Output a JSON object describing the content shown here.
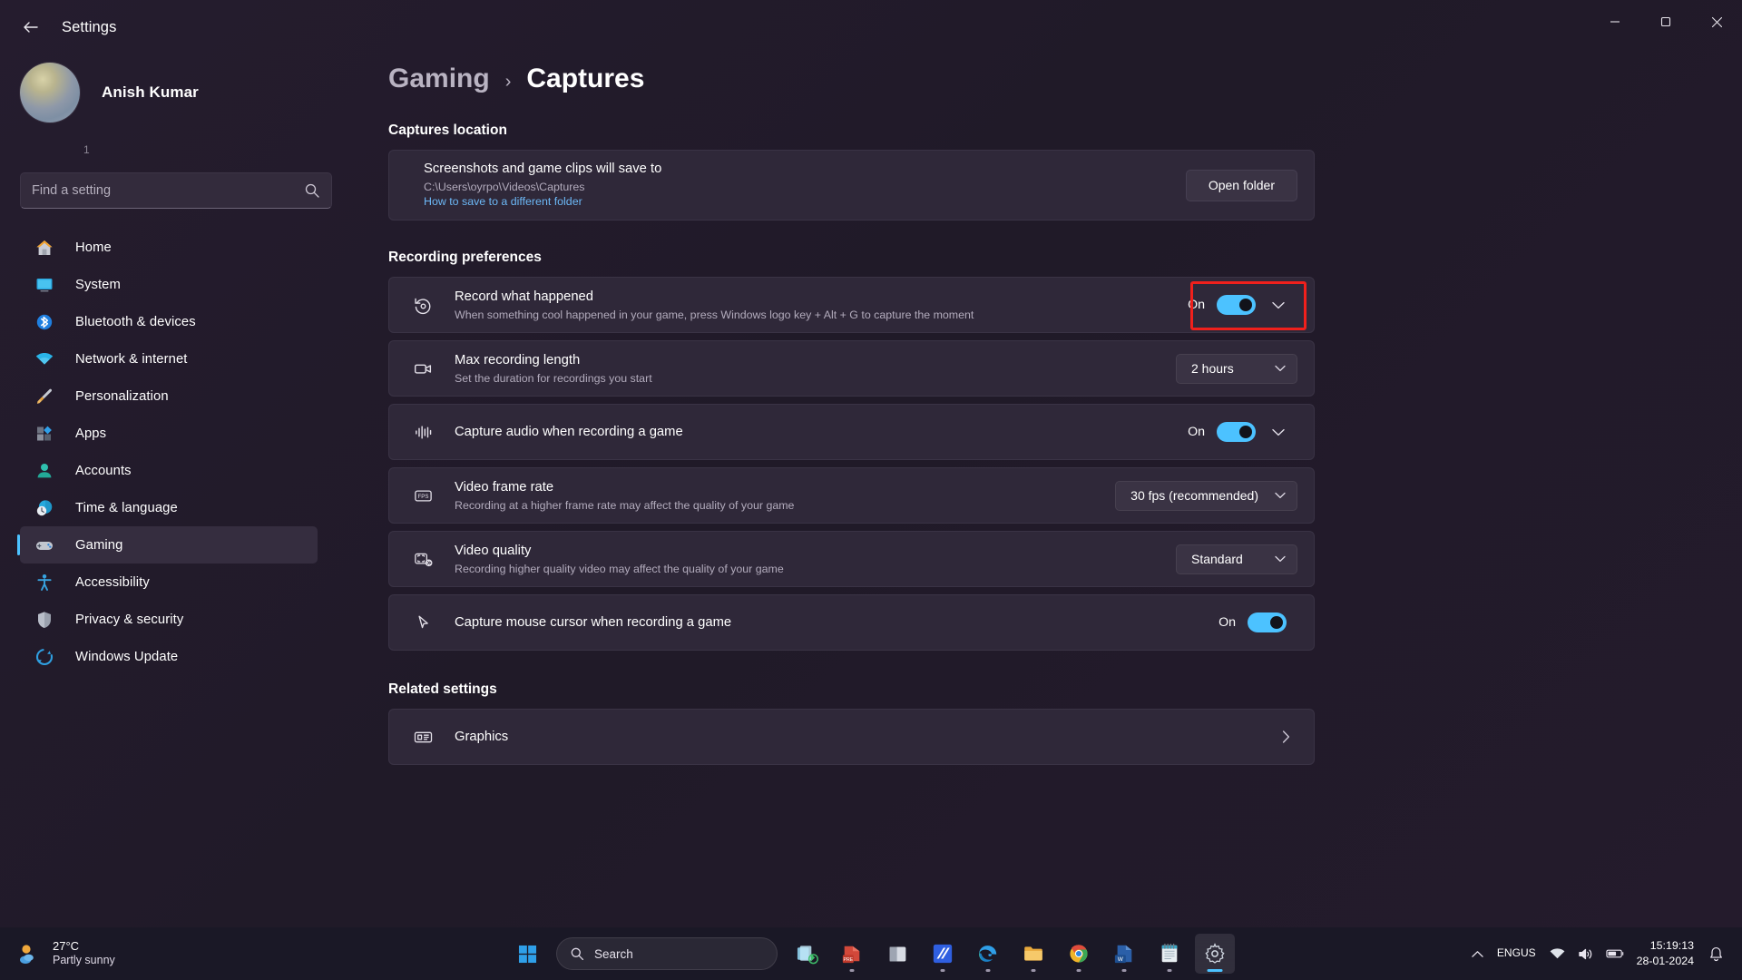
{
  "window": {
    "title": "Settings",
    "back_label": "Back",
    "minimize_label": "Minimize",
    "maximize_label": "Restore",
    "close_label": "Close"
  },
  "sidebar": {
    "profile": {
      "name": "Anish Kumar",
      "sub": "1"
    },
    "search": {
      "placeholder": "Find a setting",
      "value": ""
    },
    "items": [
      {
        "label": "Home",
        "icon": "home-icon",
        "active": false
      },
      {
        "label": "System",
        "icon": "system-icon",
        "active": false
      },
      {
        "label": "Bluetooth & devices",
        "icon": "bluetooth-icon",
        "active": false
      },
      {
        "label": "Network & internet",
        "icon": "wifi-icon",
        "active": false
      },
      {
        "label": "Personalization",
        "icon": "paintbrush-icon",
        "active": false
      },
      {
        "label": "Apps",
        "icon": "apps-icon",
        "active": false
      },
      {
        "label": "Accounts",
        "icon": "account-icon",
        "active": false
      },
      {
        "label": "Time & language",
        "icon": "clock-globe-icon",
        "active": false
      },
      {
        "label": "Gaming",
        "icon": "gamepad-icon",
        "active": true
      },
      {
        "label": "Accessibility",
        "icon": "accessibility-icon",
        "active": false
      },
      {
        "label": "Privacy & security",
        "icon": "shield-icon",
        "active": false
      },
      {
        "label": "Windows Update",
        "icon": "update-icon",
        "active": false
      }
    ]
  },
  "breadcrumb": {
    "parent": "Gaming",
    "separator": "›",
    "current": "Captures"
  },
  "sections": {
    "captures_location": {
      "heading": "Captures location",
      "title": "Screenshots and game clips will save to",
      "path": "C:\\Users\\oyrpo\\Videos\\Captures",
      "link": "How to save to a different folder",
      "button": "Open folder"
    },
    "recording_preferences": {
      "heading": "Recording preferences",
      "rows": [
        {
          "icon": "record-history-icon",
          "title": "Record what happened",
          "sub": "When something cool happened in your game, press Windows logo key + Alt + G to capture the moment",
          "control": "toggle",
          "state": "On",
          "expandable": true,
          "highlighted": true
        },
        {
          "icon": "video-camera-icon",
          "title": "Max recording length",
          "sub": "Set the duration for recordings you start",
          "control": "dropdown",
          "value": "2 hours",
          "expandable": false,
          "highlighted": false
        },
        {
          "icon": "audio-waveform-icon",
          "title": "Capture audio when recording a game",
          "sub": "",
          "control": "toggle",
          "state": "On",
          "expandable": true,
          "highlighted": false
        },
        {
          "icon": "fps-icon",
          "title": "Video frame rate",
          "sub": "Recording at a higher frame rate may affect the quality of your game",
          "control": "dropdown",
          "value": "30 fps (recommended)",
          "expandable": false,
          "highlighted": false
        },
        {
          "icon": "video-quality-icon",
          "title": "Video quality",
          "sub": "Recording higher quality video may affect the quality of your game",
          "control": "dropdown",
          "value": "Standard",
          "expandable": false,
          "highlighted": false
        },
        {
          "icon": "mouse-cursor-icon",
          "title": "Capture mouse cursor when recording a game",
          "sub": "",
          "control": "toggle",
          "state": "On",
          "expandable": false,
          "highlighted": false
        }
      ]
    },
    "related_settings": {
      "heading": "Related settings",
      "rows": [
        {
          "icon": "graphics-icon",
          "title": "Graphics"
        }
      ]
    }
  },
  "taskbar": {
    "weather": {
      "temp": "27°C",
      "desc": "Partly sunny"
    },
    "search": {
      "placeholder": "Search"
    },
    "apps": [
      {
        "name": "start-button",
        "icon": "windows-logo-icon"
      },
      {
        "name": "taskbar-search",
        "icon": "search-icon"
      },
      {
        "name": "taskview-button",
        "icon": "task-view-icon"
      },
      {
        "name": "powerpoint-app",
        "icon": "powerpoint-icon"
      },
      {
        "name": "file-explorer-alt-app",
        "icon": "window-icon"
      },
      {
        "name": "visual-studio-app",
        "icon": "vs-icon"
      },
      {
        "name": "edge-app",
        "icon": "edge-icon"
      },
      {
        "name": "file-explorer-app",
        "icon": "folder-icon"
      },
      {
        "name": "chrome-app",
        "icon": "chrome-icon"
      },
      {
        "name": "word-app",
        "icon": "word-icon"
      },
      {
        "name": "notepad-app",
        "icon": "notepad-icon"
      },
      {
        "name": "settings-app",
        "icon": "gear-icon"
      }
    ],
    "tray": {
      "chevron": "show-hidden-icons",
      "language_line1": "ENG",
      "language_line2": "US",
      "time": "15:19:13",
      "date": "28-01-2024"
    },
    "colors": {
      "accent": "#4cc2ff",
      "highlight": "#f0201c"
    }
  }
}
